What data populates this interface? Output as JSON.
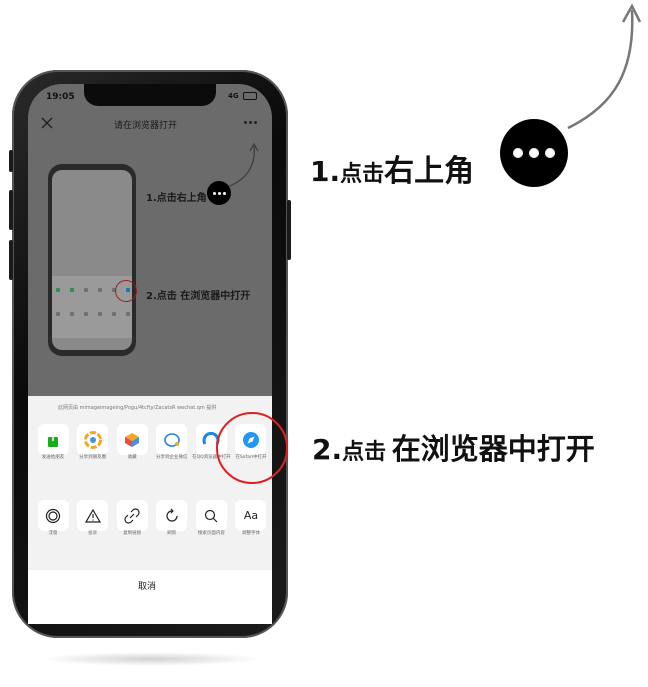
{
  "status": {
    "time": "19:05",
    "signal": "4G"
  },
  "topbar": {
    "title": "请在浏览器打开",
    "close_icon": "close-icon",
    "more_icon": "more-icon"
  },
  "guide": {
    "step1_small": "1.点击右上角",
    "step2_small": "2.点击 在浏览器中打开"
  },
  "sheet": {
    "note": "此网页由 mimageimageing/Pogu/4tcfty/ZacatsR wechat.qm 提供",
    "row1": [
      {
        "icon": "send-to-chat-icon",
        "label": "发送给朋友"
      },
      {
        "icon": "moments-icon",
        "label": "分享到朋友圈"
      },
      {
        "icon": "favorite-icon",
        "label": "收藏"
      },
      {
        "icon": "wework-icon",
        "label": "分享到企业微信"
      },
      {
        "icon": "qq-browser-icon",
        "label": "在QQ浏览器中打开"
      },
      {
        "icon": "safari-icon",
        "label": "在Safari中打开"
      }
    ],
    "row2": [
      {
        "icon": "float-window-icon",
        "label": "浮窗"
      },
      {
        "icon": "report-icon",
        "label": "投诉"
      },
      {
        "icon": "copy-link-icon",
        "label": "复制链接"
      },
      {
        "icon": "refresh-icon",
        "label": "刷新"
      },
      {
        "icon": "search-page-icon",
        "label": "搜索页面内容"
      },
      {
        "icon": "font-size-icon",
        "label": "调整字体",
        "glyph": "Aa"
      }
    ],
    "cancel": "取消"
  },
  "callouts": {
    "step1_num": "1.",
    "step1_small": "点击",
    "step1_big": "右上角",
    "step2_num": "2.",
    "step2_small": "点击",
    "step2_big": "在浏览器中打开"
  },
  "colors": {
    "highlight": "#e02020",
    "accent_green": "#07c160"
  }
}
